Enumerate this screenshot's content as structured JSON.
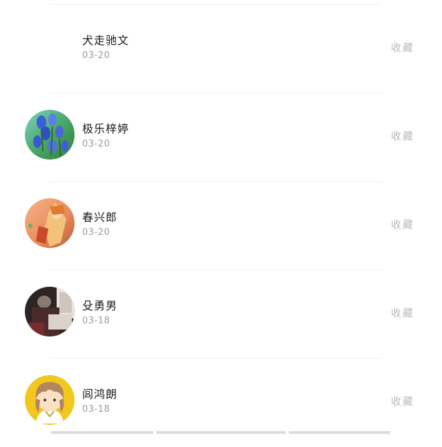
{
  "favorite_label": "收藏",
  "items": [
    {
      "name": "犬走驰文",
      "date": "03-20",
      "avatar": "none"
    },
    {
      "name": "极乐梓婷",
      "date": "03-20",
      "avatar": "blue-flowers"
    },
    {
      "name": "春兴郎",
      "date": "03-20",
      "avatar": "orange-anime"
    },
    {
      "name": "殳勇男",
      "date": "03-18",
      "avatar": "dark-photo"
    },
    {
      "name": "闾鸿朗",
      "date": "03-18",
      "avatar": "yellow-cartoon"
    }
  ]
}
